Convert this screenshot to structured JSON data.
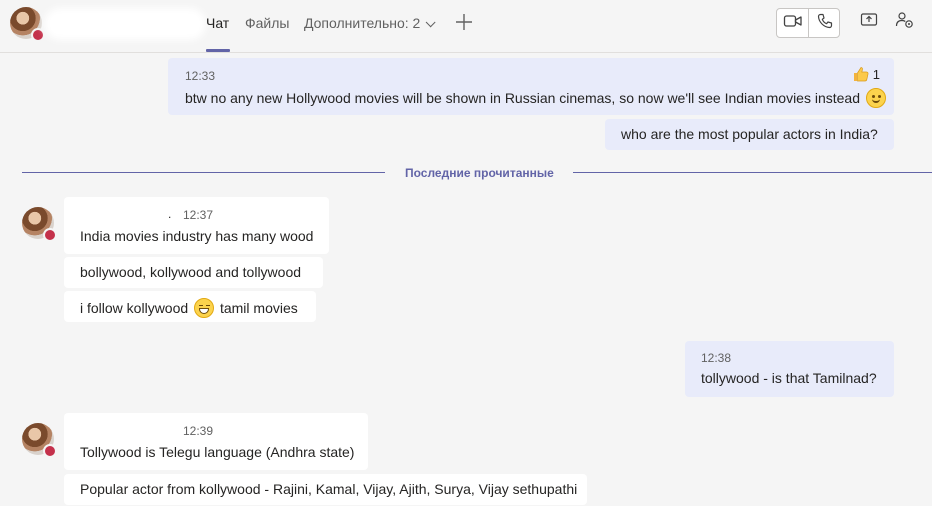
{
  "header": {
    "tabs": [
      {
        "label": "Чат",
        "active": true
      },
      {
        "label": "Файлы",
        "active": false
      },
      {
        "label": "Дополнительно: 2",
        "active": false
      }
    ],
    "icons": [
      "add-tab-icon",
      "video-call-icon",
      "audio-call-icon",
      "share-screen-icon",
      "people-settings-icon"
    ]
  },
  "colors": {
    "accent": "#6264a7",
    "outgoing_bubble": "#e8ebfa",
    "incoming_bubble": "#ffffff",
    "presence_busy": "#c4314b"
  },
  "messages": {
    "out1": {
      "time": "12:33",
      "text": "btw no any new Hollywood movies will be shown in Russian cinemas, so now we'll see Indian movies instead",
      "reaction_count": "1"
    },
    "out2": {
      "text": "who are the most popular actors in India?"
    },
    "divider": "Последние прочитанные",
    "in1": {
      "sender_mark": ".",
      "time": "12:37",
      "lines": [
        "India movies industry has many wood",
        "bollywood, kollywood and tollywood",
        "i follow kollywood",
        "tamil movies"
      ]
    },
    "out3": {
      "time": "12:38",
      "text": "tollywood - is that Tamilnad?"
    },
    "in2": {
      "time": "12:39",
      "lines": [
        "Tollywood is Telegu language (Andhra state)",
        "Popular actor from kollywood - Rajini, Kamal, Vijay, Ajith, Surya, Vijay sethupathi"
      ]
    }
  }
}
